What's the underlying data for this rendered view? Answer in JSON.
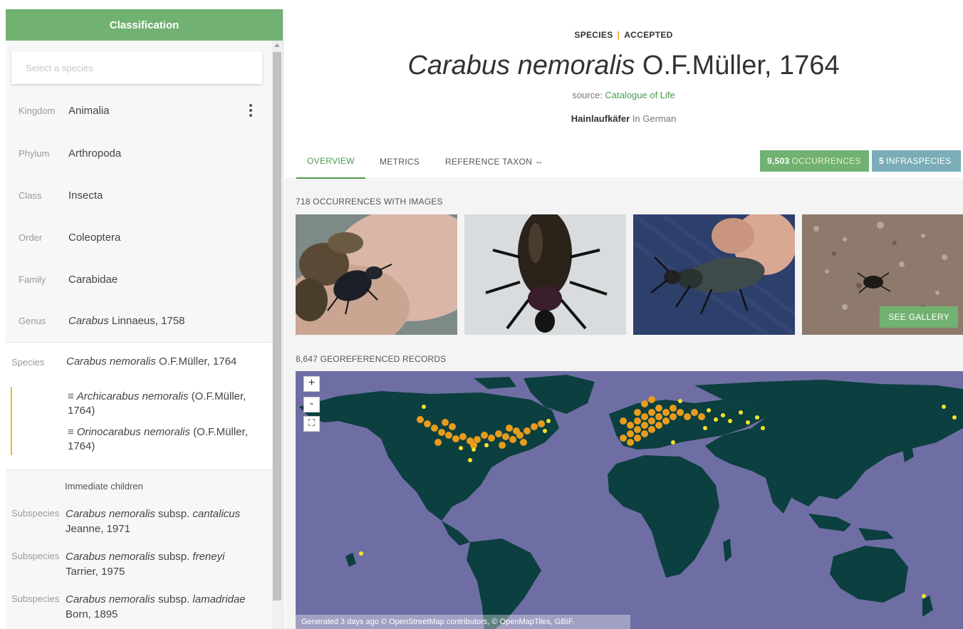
{
  "sidebar": {
    "title": "Classification",
    "search_placeholder": "Select a species",
    "ranks": [
      {
        "label": "Kingdom",
        "value": "Animalia"
      },
      {
        "label": "Phylum",
        "value": "Arthropoda"
      },
      {
        "label": "Class",
        "value": "Insecta"
      },
      {
        "label": "Order",
        "value": "Coleoptera"
      },
      {
        "label": "Family",
        "value": "Carabidae"
      }
    ],
    "genus": {
      "label": "Genus",
      "name": "Carabus",
      "author": " Linnaeus, 1758"
    },
    "species": {
      "label": "Species",
      "name": "Carabus nemoralis",
      "author": " O.F.Müller, 1764"
    },
    "synonyms": [
      {
        "name": "Archicarabus nemoralis",
        "author": " (O.F.Müller, 1764)"
      },
      {
        "name": "Orinocarabus nemoralis",
        "author": " (O.F.Müller, 1764)"
      }
    ],
    "synonym_marker": "≡",
    "children_heading": "Immediate children",
    "children": [
      {
        "rank": "Subspecies",
        "name": "Carabus nemoralis",
        "mid": " subsp. ",
        "epithet": "cantalicus",
        "author": "Jeanne, 1971"
      },
      {
        "rank": "Subspecies",
        "name": "Carabus nemoralis",
        "mid": " subsp. ",
        "epithet": "freneyi",
        "author": "Tarrier, 1975"
      },
      {
        "rank": "Subspecies",
        "name": "Carabus nemoralis",
        "mid": " subsp. ",
        "epithet": "lamadridae",
        "author": "Born, 1895"
      }
    ]
  },
  "header": {
    "status_left": "SPECIES",
    "status_sep": "|",
    "status_right": "ACCEPTED",
    "sci_name": "Carabus nemoralis",
    "author": " O.F.Müller, 1764",
    "source_prefix": "source: ",
    "source_link": "Catalogue of Life",
    "vernacular_name": "Hainlaufkäfer",
    "vernacular_lang": " In German"
  },
  "tabs": [
    {
      "label": "OVERVIEW"
    },
    {
      "label": "METRICS"
    },
    {
      "label": "REFERENCE TAXON ⇔"
    }
  ],
  "badges": {
    "occurrences_count": "9,503",
    "occurrences_label": "OCCURRENCES",
    "infraspecies_count": "5",
    "infraspecies_label": "INFRASPECIES"
  },
  "images_heading": "718 OCCURRENCES WITH IMAGES",
  "gallery_button": "SEE GALLERY",
  "map_heading": "8,647 GEOREFERENCED RECORDS",
  "map": {
    "zoom_in": "+",
    "zoom_out": "-",
    "fullscreen": "⛶",
    "attribution": "Generated 3 days ago © OpenStreetMap contributors, © OpenMapTiles, GBIF."
  },
  "colors": {
    "accent": "#71b171",
    "link": "#4b9a4b",
    "status_sep": "#e89c1e",
    "ocean": "#6e6ea4",
    "land": "#0c3f3f"
  }
}
